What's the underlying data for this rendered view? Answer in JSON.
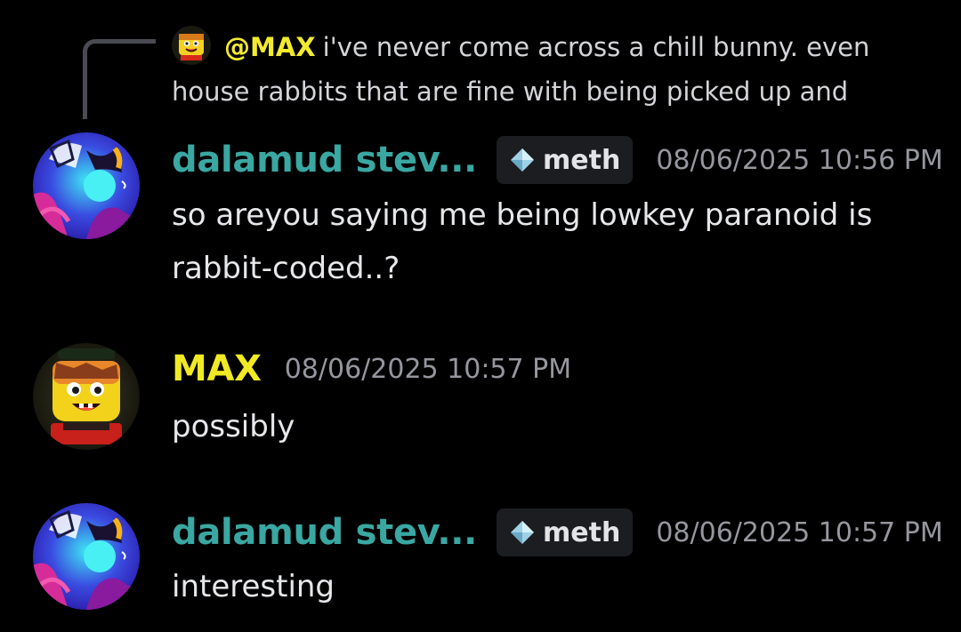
{
  "reply": {
    "mention": "@MAX",
    "text": "i've never come across a chill bunny. even house rabbits that are fine with being picked up and"
  },
  "messages": [
    {
      "username": "dalamud stev...",
      "tag": "meth",
      "timestamp": "08/06/2025 10:56 PM",
      "body": "so areyou saying me being lowkey paranoid is rabbit-coded..?"
    },
    {
      "username": "MAX",
      "timestamp": "08/06/2025 10:57 PM",
      "body": "possibly"
    },
    {
      "username": "dalamud stev...",
      "tag": "meth",
      "timestamp": "08/06/2025 10:57 PM",
      "body": "interesting"
    }
  ],
  "colors": {
    "background": "#000000",
    "username_dalamud": "#3aa7a2",
    "username_max": "#f0ea24",
    "mention": "#f3ea2f",
    "timestamp": "#96979e",
    "tag_bg": "#1c1d21"
  },
  "icons": {
    "tag_icon": "diamond-gem-icon",
    "reply_connector": "reply-spine"
  }
}
